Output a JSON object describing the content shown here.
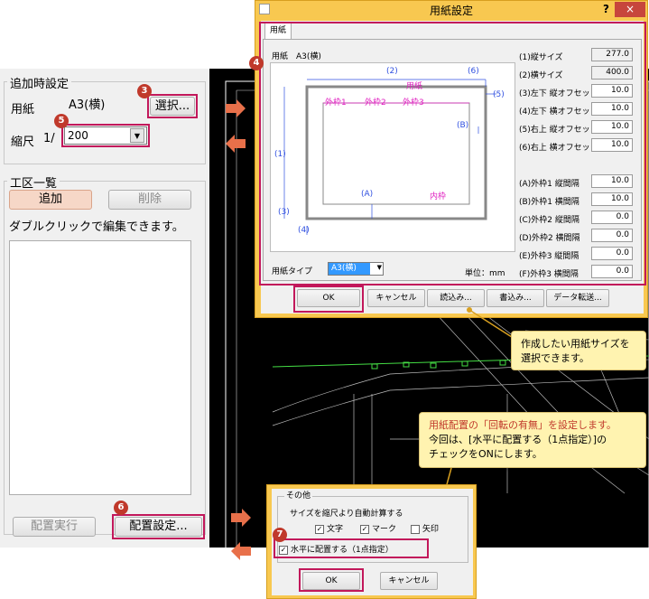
{
  "left_panel": {
    "add_settings_label": "追加時設定",
    "paper_label": "用紙",
    "paper_value": "A3(横)",
    "select_button": "選択...",
    "scale_label": "縮尺",
    "scale_prefix": "1/",
    "scale_value": "200",
    "section_list_label": "工区一覧",
    "add_button": "追加",
    "delete_button": "削除",
    "hint_text": "ダブルクリックで編集できます。",
    "execute_button": "配置実行",
    "placement_settings_button": "配置設定..."
  },
  "badges": {
    "b3": "3",
    "b4": "4",
    "b5": "5",
    "b6": "6",
    "b7": "7"
  },
  "paper_dialog": {
    "title": "用紙設定",
    "help": "?",
    "close": "×",
    "tab": "用紙",
    "paper_caption": "用紙　A3(横)",
    "diagram_labels": {
      "l1": "(1)",
      "l2": "(2)",
      "l3": "(3)",
      "l4": "(4)",
      "l5": "(5)",
      "l6": "(6)",
      "lA": "(A)",
      "lB": "(B)",
      "frame1": "外枠1",
      "frame2": "外枠2",
      "frame3": "外枠3",
      "paper": "用紙",
      "inner": "内枠"
    },
    "paper_type_label": "用紙タイプ",
    "paper_type_value": "A3(横)",
    "unit_label": "単位：mm",
    "fields": [
      {
        "label": "(1)縦サイズ",
        "value": "277.0"
      },
      {
        "label": "(2)横サイズ",
        "value": "400.0"
      },
      {
        "label": "(3)左下 縦オフセット",
        "value": "10.0"
      },
      {
        "label": "(4)左下 横オフセット",
        "value": "10.0"
      },
      {
        "label": "(5)右上 縦オフセット",
        "value": "10.0"
      },
      {
        "label": "(6)右上 横オフセット",
        "value": "10.0"
      },
      {
        "label": "(A)外枠1 縦間隔",
        "value": "10.0"
      },
      {
        "label": "(B)外枠1 横間隔",
        "value": "10.0"
      },
      {
        "label": "(C)外枠2 縦間隔",
        "value": "0.0"
      },
      {
        "label": "(D)外枠2 横間隔",
        "value": "0.0"
      },
      {
        "label": "(E)外枠3 縦間隔",
        "value": "0.0"
      },
      {
        "label": "(F)外枠3 横間隔",
        "value": "0.0"
      }
    ],
    "buttons": {
      "ok": "OK",
      "cancel": "キャンセル",
      "load": "読込み...",
      "save": "書込み...",
      "transfer": "データ転送..."
    }
  },
  "callout1": {
    "line1": "作成したい用紙サイズを",
    "line2": "選択できます。"
  },
  "callout2": {
    "line1": "用紙配置の「回転の有無」を設定します。",
    "line2": "今回は、[水平に配置する（1点指定）]の",
    "line3": "チェックをONにします。"
  },
  "other_dialog": {
    "group_label": "その他",
    "auto_calc_label": "サイズを縮尺より自動計算する",
    "chk_text": "文字",
    "chk_mark": "マーク",
    "chk_arrow": "矢印",
    "chk_horizontal": "水平に配置する（1点指定）",
    "ok": "OK",
    "cancel": "キャンセル"
  },
  "colors": {
    "accent_border": "#c2185b",
    "badge": "#c0392b",
    "arrow": "#e8704a",
    "dialog_frame": "#f8c850",
    "callout": "#fff3b0"
  }
}
